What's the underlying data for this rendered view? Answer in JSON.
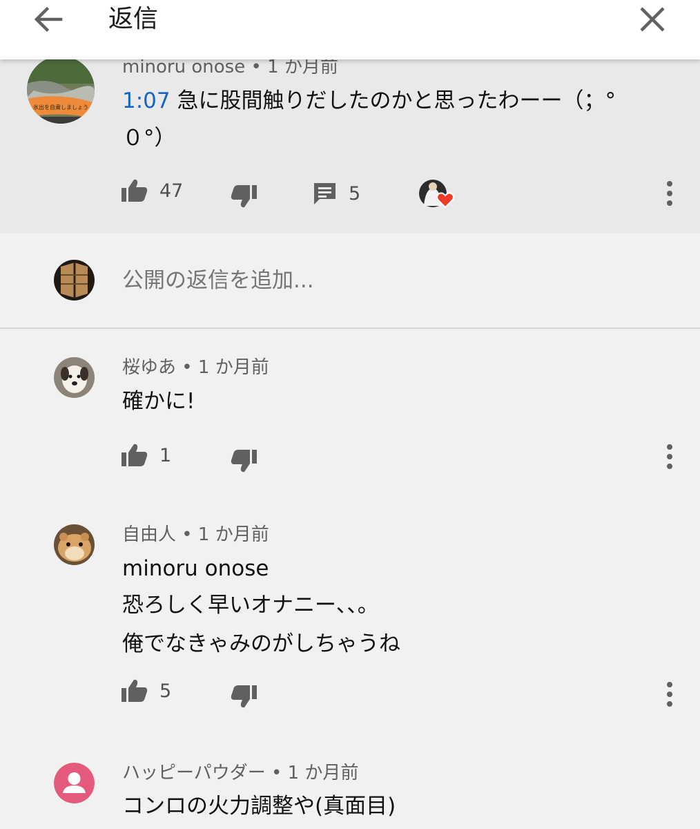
{
  "header": {
    "title": "返信"
  },
  "parent_comment": {
    "author": "minoru onose",
    "age": "1 か月前",
    "timestamp_link": "1:07",
    "text_line1": "急に股間触りだしたのかと思ったわーー（；°",
    "text_line2": "０°）",
    "likes": "47",
    "replies": "5"
  },
  "reply_input": {
    "placeholder": "公開の返信を追加..."
  },
  "replies": [
    {
      "author": "桜ゆあ",
      "age": "1 か月前",
      "lines": [
        "確かに!"
      ],
      "likes": "1"
    },
    {
      "author": "自由人",
      "age": "1 か月前",
      "lines": [
        "minoru onose",
        "恐ろしく早いオナニー、、。",
        "俺でなきゃみのがしちゃうね"
      ],
      "likes": "5"
    },
    {
      "author": "ハッピーパウダー",
      "age": "1 か月前",
      "lines": [
        "コンロの火力調整や(真面目)"
      ]
    }
  ],
  "colors": {
    "link": "#1565c0",
    "heart": "#ef3b24",
    "default_avatar": "#e45a7c"
  },
  "separator": " • "
}
